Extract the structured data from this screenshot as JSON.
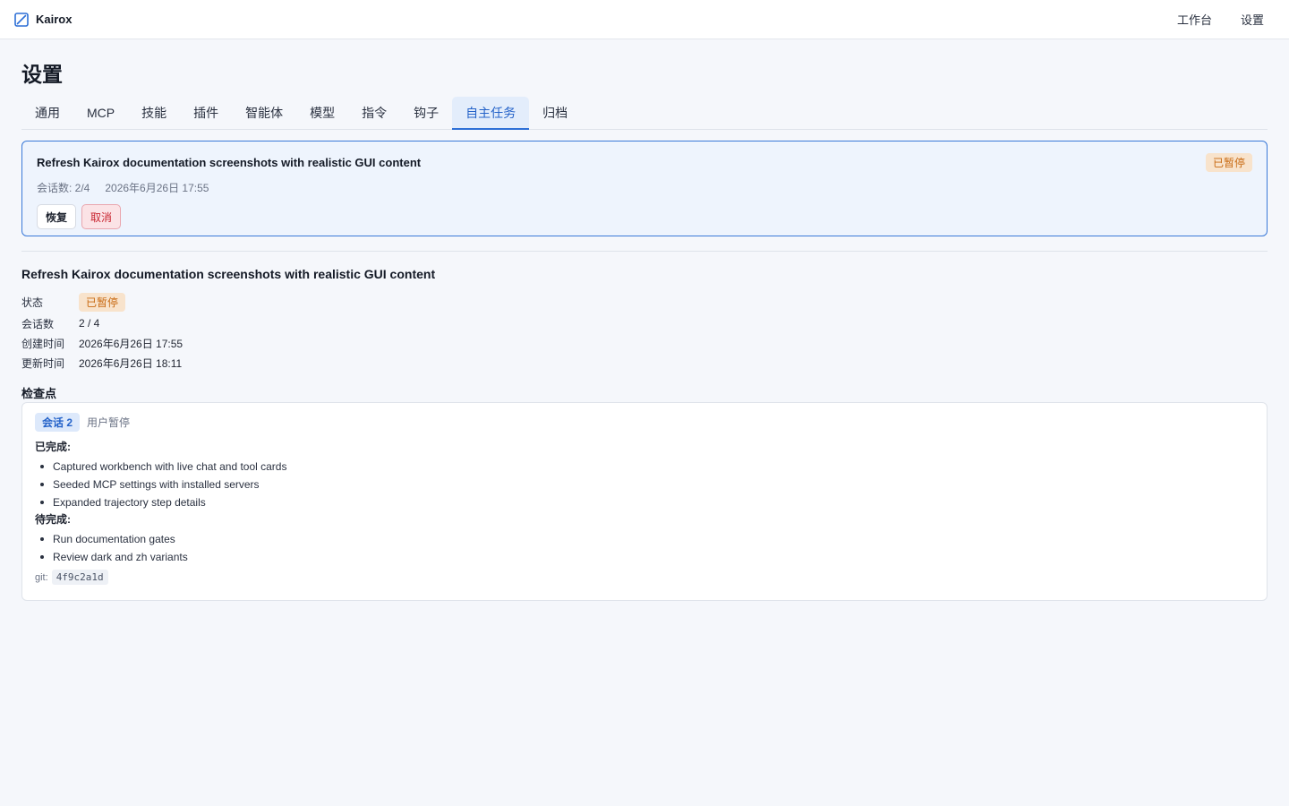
{
  "app": {
    "name": "Kairox",
    "logo_icon": "kairox-logo-icon"
  },
  "topnav": {
    "workbench": "工作台",
    "settings": "设置"
  },
  "page": {
    "title": "设置"
  },
  "tabs": [
    {
      "label": "通用",
      "active": false
    },
    {
      "label": "MCP",
      "active": false
    },
    {
      "label": "技能",
      "active": false
    },
    {
      "label": "插件",
      "active": false
    },
    {
      "label": "智能体",
      "active": false
    },
    {
      "label": "模型",
      "active": false
    },
    {
      "label": "指令",
      "active": false
    },
    {
      "label": "钩子",
      "active": false
    },
    {
      "label": "自主任务",
      "active": true
    },
    {
      "label": "归档",
      "active": false
    }
  ],
  "task_card": {
    "title": "Refresh Kairox documentation screenshots with realistic GUI content",
    "status": "已暂停",
    "sessions": "会话数: 2/4",
    "created": "2026年6月26日 17:55",
    "resume_label": "恢复",
    "cancel_label": "取消"
  },
  "detail": {
    "title": "Refresh Kairox documentation screenshots with realistic GUI content",
    "status_key": "状态",
    "status_value": "已暂停",
    "sessions_key": "会话数",
    "sessions_value": "2 / 4",
    "created_key": "创建时间",
    "created_value": "2026年6月26日 17:55",
    "updated_key": "更新时间",
    "updated_value": "2026年6月26日 18:11"
  },
  "checkpoints": {
    "heading": "检查点",
    "session_chip": "会话 2",
    "reason": "用户暂停",
    "done_label": "已完成:",
    "done_items": [
      "Captured workbench with live chat and tool cards",
      "Seeded MCP settings with installed servers",
      "Expanded trajectory step details"
    ],
    "todo_label": "待完成:",
    "todo_items": [
      "Run documentation gates",
      "Review dark and zh variants"
    ],
    "git_label": "git:",
    "git_hash": "4f9c2a1d"
  },
  "colors": {
    "accent": "#2d6fd6",
    "paused_badge_bg": "#f8e3cc",
    "paused_badge_text": "#c86a12",
    "cancel_text": "#c8242f"
  }
}
